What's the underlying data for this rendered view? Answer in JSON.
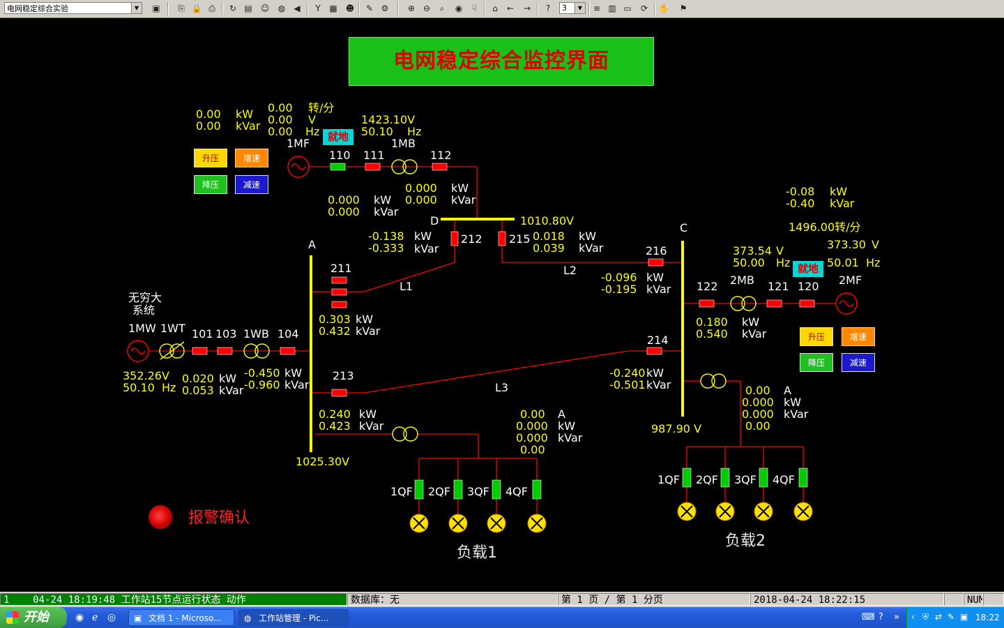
{
  "toolbar": {
    "page_combo_value": "电网稳定综合实验",
    "zoom_value": "3"
  },
  "title": "电网稳定综合监控界面",
  "gen1": {
    "p_val": "0.00",
    "p_unit": "kW",
    "q_val": "0.00",
    "q_unit": "kVar",
    "speed_val": "0.00",
    "speed_unit": "转/分",
    "volt_val": "0.00",
    "volt_unit": "V",
    "freq_val": "0.00",
    "freq_unit": "Hz",
    "bus_volt": "1423.10V",
    "bus_freq_val": "50.10",
    "bus_freq_unit": "Hz",
    "local_badge": "就地",
    "name_mf": "1MF",
    "name_mb": "1MB",
    "sw_110": "110",
    "sw_111": "111",
    "sw_112": "112",
    "btn_up": "升压",
    "btn_speedup": "增速",
    "btn_down": "降压",
    "btn_slow": "减速"
  },
  "line_112_meter": {
    "p_val": "0.000",
    "q_val": "0.000",
    "p_unit": "kW",
    "q_unit": "kVar"
  },
  "gen1_meter2": {
    "p_val": "0.000",
    "q_val": "0.000",
    "p_unit": "kW",
    "q_unit": "kVar"
  },
  "bus_d": {
    "name": "D",
    "volt": "1010.80V"
  },
  "sw_212": {
    "label": "212",
    "p_val": "-0.138",
    "q_val": "-0.333",
    "p_unit": "kW",
    "q_unit": "kVar"
  },
  "sw_215": {
    "label": "215",
    "p_val": "0.018",
    "q_val": "0.039",
    "p_unit": "kW",
    "q_unit": "kVar"
  },
  "bus_a": {
    "name": "A",
    "volt": "1025.30V"
  },
  "bus_c": {
    "name": "C",
    "volt": "987.90  V"
  },
  "sw_211": {
    "label": "211",
    "p_val": "0.303",
    "q_val": "0.432",
    "p_unit": "kW",
    "q_unit": "kVar"
  },
  "sw_213": {
    "label": "213"
  },
  "line_labels": {
    "l1": "L1",
    "l2": "L2",
    "l3": "L3"
  },
  "infinite": {
    "name_line1": "无穷大",
    "name_line2": "系统",
    "mw": "1MW",
    "wt": "1WT",
    "sw_101": "101",
    "sw_103": "103",
    "wb": "1WB",
    "sw_104": "104",
    "volt": "352.26V",
    "freq_val": "50.10",
    "freq_unit": "Hz",
    "p_val": "0.020",
    "q_val": "0.053",
    "p_unit": "kW",
    "q_unit": "kVar",
    "p2_val": "-0.450",
    "q2_val": "-0.960",
    "p2_unit": "kW",
    "q2_unit": "kVar"
  },
  "load1_feed": {
    "p_val": "0.240",
    "q_val": "0.423",
    "p_unit": "kW",
    "q_unit": "kVar"
  },
  "load1_meter": {
    "i_val": "0.00",
    "p_val": "0.000",
    "q_val": "0.000",
    "pf_val": "0.00",
    "i_unit": "A",
    "p_unit": "kW",
    "q_unit": "kVar"
  },
  "load1": {
    "sw": [
      "1QF",
      "2QF",
      "3QF",
      "4QF"
    ],
    "name": "负载1"
  },
  "gen2": {
    "p_val": "-0.08",
    "q_val": "-0.40",
    "p_unit": "kW",
    "q_unit": "kVar",
    "speed": "1496.00转/分",
    "bus_volt_val": "373.54",
    "bus_volt_unit": "V",
    "bus_freq_val": "50.00",
    "bus_freq_unit": "Hz",
    "gen_volt_val": "373.30",
    "gen_volt_unit": "V",
    "gen_freq_val": "50.01",
    "gen_freq_unit": "Hz",
    "local_badge": "就地",
    "name_mf": "2MF",
    "name_mb": "2MB",
    "sw_122": "122",
    "sw_121": "121",
    "sw_120": "120",
    "meter_p_val": "0.180",
    "meter_q_val": "0.540",
    "meter_p_unit": "kW",
    "meter_q_unit": "kVar",
    "btn_up": "升压",
    "btn_speedup": "增速",
    "btn_down": "降压",
    "btn_slow": "减速"
  },
  "sw_216": {
    "label": "216",
    "p_val": "-0.096",
    "q_val": "-0.195",
    "p_unit": "kW",
    "q_unit": "kVar"
  },
  "sw_214": {
    "label": "214",
    "p_val": "-0.240",
    "q_val": "-0.501",
    "p_unit": "kW",
    "q_unit": "kVar"
  },
  "load2_meter": {
    "i_val": "0.00",
    "p_val": "0.000",
    "q_val": "0.000",
    "pf_val": "0.00",
    "i_unit": "A",
    "p_unit": "kW",
    "q_unit": "kVar"
  },
  "load2": {
    "sw": [
      "1QF",
      "2QF",
      "3QF",
      "4QF"
    ],
    "name": "负载2"
  },
  "alarm": {
    "label": "报警确认"
  },
  "status": {
    "event_index": "1",
    "event_text": "04-24 18:19:48  工作站15节点运行状态   动作",
    "database": "数据库：无",
    "page": "第 1 页 / 第 1 分页",
    "datetime": "2018-04-24 18:22:15",
    "num": "NUM"
  },
  "taskbar": {
    "start": "开始",
    "task1": "文档 1 - Microso...",
    "task2": "工作站管理 - Pic...",
    "clock": "18:22"
  },
  "colors": {
    "breaker_closed": "#ff0000",
    "breaker_open": "#00cc00",
    "bus": "#ffff00",
    "wire": "#ff0000"
  }
}
